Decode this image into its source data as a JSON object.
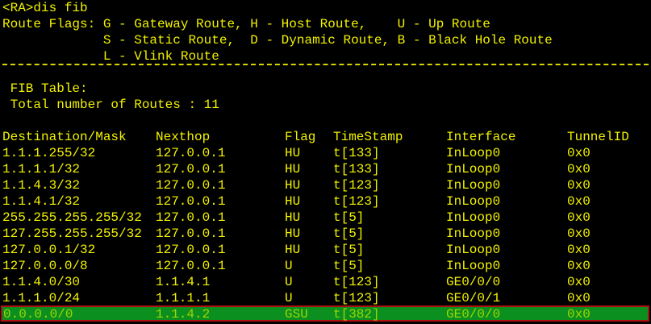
{
  "terminal": {
    "prompt_line": "<RA>dis fib",
    "flags_lines": [
      "Route Flags: G - Gateway Route, H - Host Route,    U - Up Route",
      "             S - Static Route,  D - Dynamic Route, B - Black Hole Route",
      "             L - Vlink Route"
    ],
    "fib_title": " FIB Table:",
    "route_total": " Total number of Routes : 11",
    "colors": {
      "text": "#f2f200",
      "background": "#000000",
      "highlight_bg": "#0b8f1f",
      "highlight_border": "#b01010"
    }
  },
  "table": {
    "headers": [
      "Destination/Mask",
      "Nexthop",
      "Flag",
      "TimeStamp",
      "Interface",
      "TunnelID"
    ],
    "rows": [
      [
        "1.1.1.255/32",
        "127.0.0.1",
        "HU",
        "t[133]",
        "InLoop0",
        "0x0"
      ],
      [
        "1.1.1.1/32",
        "127.0.0.1",
        "HU",
        "t[133]",
        "InLoop0",
        "0x0"
      ],
      [
        "1.1.4.3/32",
        "127.0.0.1",
        "HU",
        "t[123]",
        "InLoop0",
        "0x0"
      ],
      [
        "1.1.4.1/32",
        "127.0.0.1",
        "HU",
        "t[123]",
        "InLoop0",
        "0x0"
      ],
      [
        "255.255.255.255/32",
        "127.0.0.1",
        "HU",
        "t[5]",
        "InLoop0",
        "0x0"
      ],
      [
        "127.255.255.255/32",
        "127.0.0.1",
        "HU",
        "t[5]",
        "InLoop0",
        "0x0"
      ],
      [
        "127.0.0.1/32",
        "127.0.0.1",
        "HU",
        "t[5]",
        "InLoop0",
        "0x0"
      ],
      [
        "127.0.0.0/8",
        "127.0.0.1",
        "U",
        "t[5]",
        "InLoop0",
        "0x0"
      ],
      [
        "1.1.4.0/30",
        "1.1.4.1",
        "U",
        "t[123]",
        "GE0/0/0",
        "0x0"
      ],
      [
        "1.1.1.0/24",
        "1.1.1.1",
        "U",
        "t[123]",
        "GE0/0/1",
        "0x0"
      ],
      [
        "0.0.0.0/0",
        "1.1.4.2",
        "GSU",
        "t[382]",
        "GE0/0/0",
        "0x0"
      ]
    ]
  }
}
